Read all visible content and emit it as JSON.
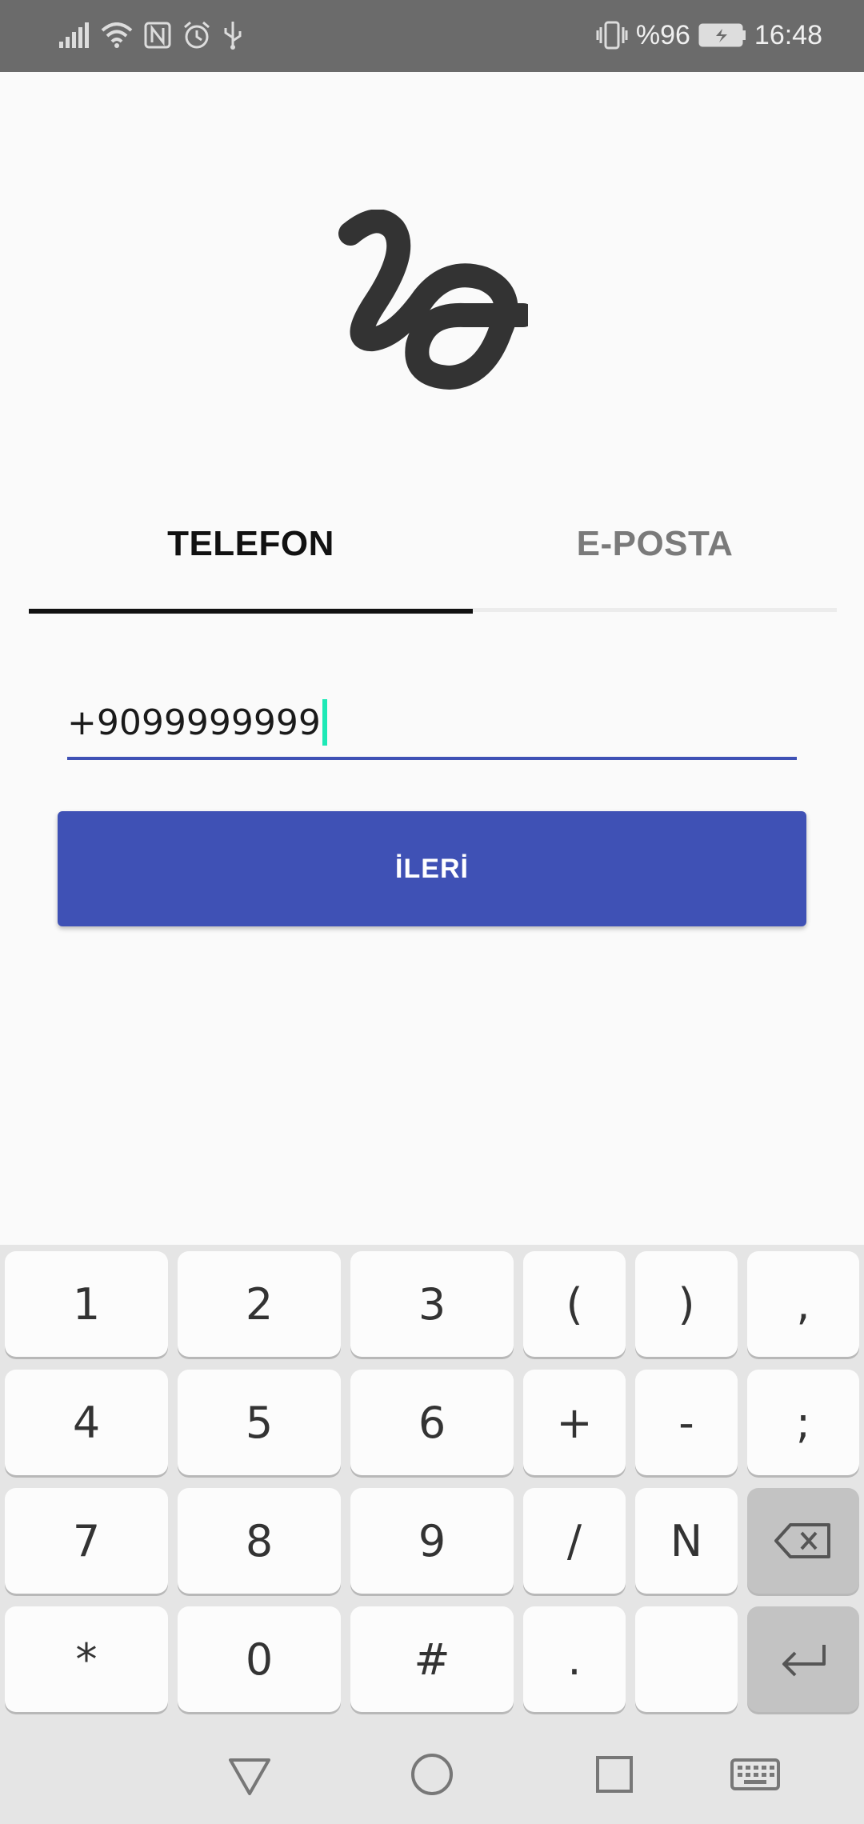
{
  "status_bar": {
    "battery_text": "%96",
    "time": "16:48"
  },
  "tabs": {
    "phone": "TELEFON",
    "email": "E-POSTA"
  },
  "phone_input": {
    "value": "+9099999999"
  },
  "next_button": {
    "label": "İLERİ"
  },
  "keyboard": {
    "rows": [
      [
        "1",
        "2",
        "3",
        "(",
        ")",
        ","
      ],
      [
        "4",
        "5",
        "6",
        "+",
        "-",
        ";"
      ],
      [
        "7",
        "8",
        "9",
        "/",
        "N",
        "backspace"
      ],
      [
        "*",
        "0",
        "#",
        ".",
        "",
        "enter"
      ]
    ]
  },
  "colors": {
    "primary": "#3f51b5",
    "status_bar": "#6b6b6b",
    "cursor": "#1de9b6",
    "tab_indicator": "#111111"
  }
}
